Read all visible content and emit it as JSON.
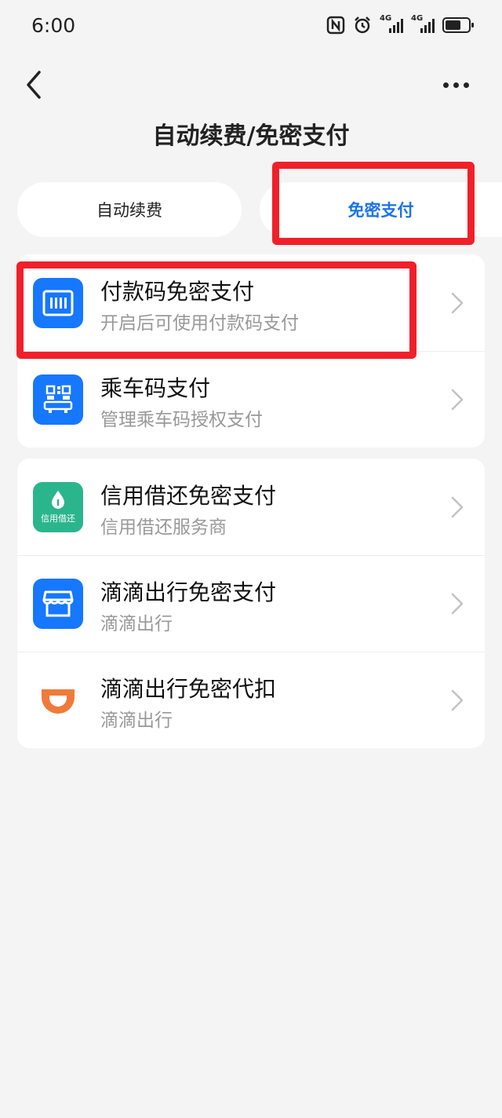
{
  "status_bar": {
    "time": "6:00",
    "net1": "4G",
    "net2": "4G"
  },
  "header": {
    "title": "自动续费/免密支付"
  },
  "tabs": [
    {
      "label": "自动续费",
      "selected": false
    },
    {
      "label": "免密支付",
      "selected": true
    }
  ],
  "cards": [
    {
      "items": [
        {
          "title": "付款码免密支付",
          "subtitle": "开启后可使用付款码支付",
          "icon": "barcode-icon"
        },
        {
          "title": "乘车码支付",
          "subtitle": "管理乘车码授权支付",
          "icon": "bus-qr-icon"
        }
      ]
    },
    {
      "items": [
        {
          "title": "信用借还免密支付",
          "subtitle": "信用借还服务商",
          "icon": "credit-borrow-icon",
          "icon_text": "信用借还"
        },
        {
          "title": "滴滴出行免密支付",
          "subtitle": "滴滴出行",
          "icon": "store-icon"
        },
        {
          "title": "滴滴出行免密代扣",
          "subtitle": "滴滴出行",
          "icon": "didi-logo-icon"
        }
      ]
    }
  ],
  "colors": {
    "accent": "#1a73e8",
    "icon_blue": "#1677ff",
    "icon_green": "#2ab58d",
    "didi_orange": "#f07a3a",
    "highlight": "#f0202a"
  }
}
